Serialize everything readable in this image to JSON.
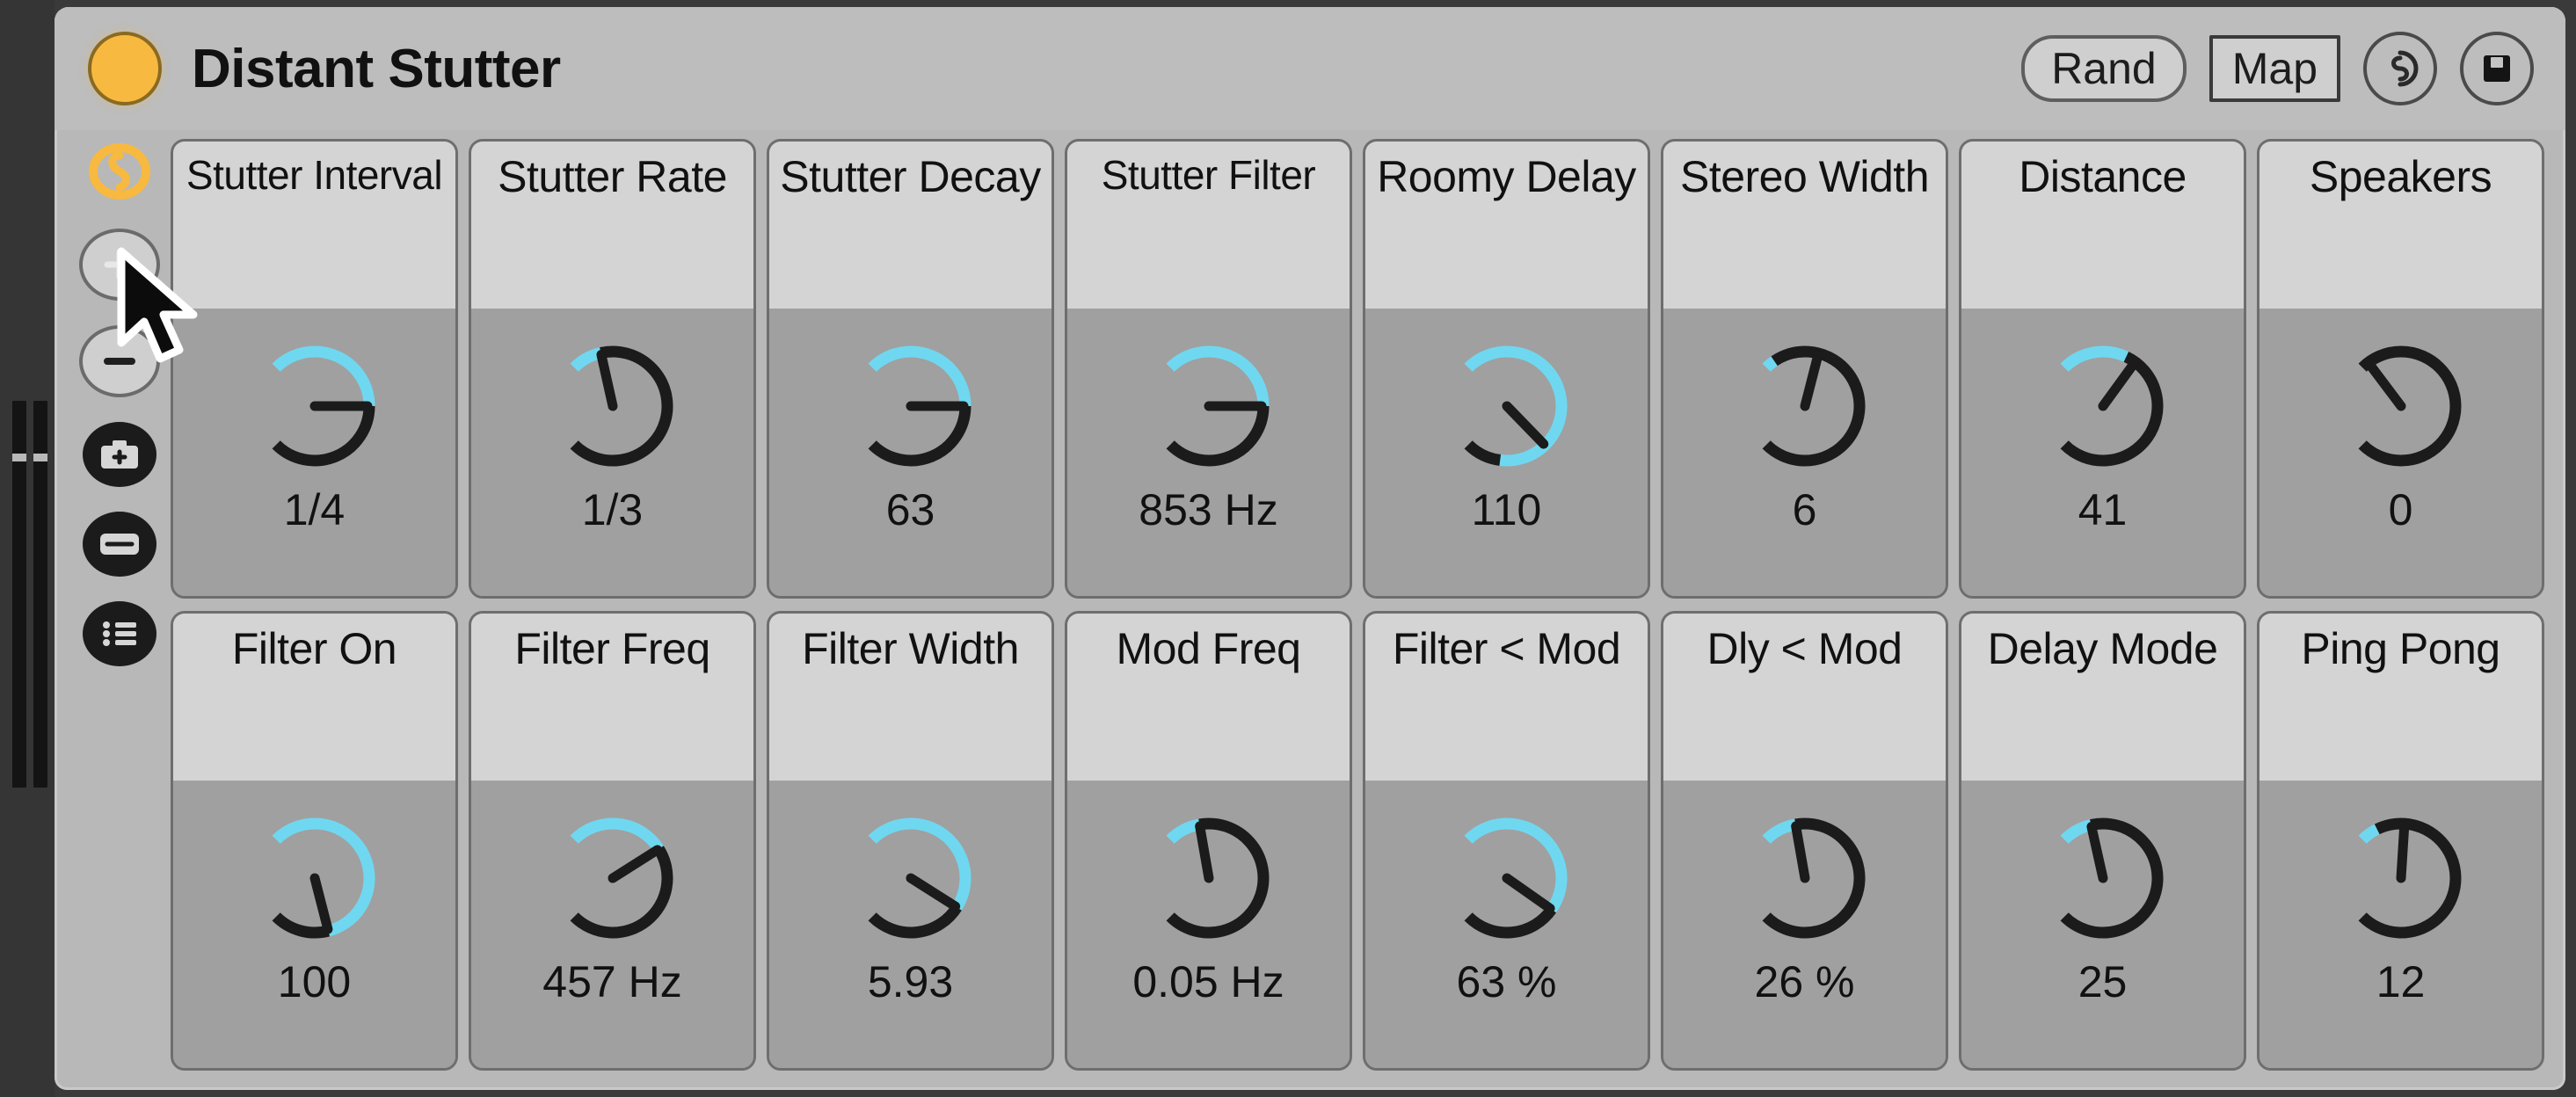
{
  "device": {
    "title": "Distant Stutter",
    "power_state": "on",
    "accent_color": "#f7b93f",
    "knob_active_color": "#6fd8f0",
    "knob_track_color": "#1b1b1b",
    "panel_color": "#b8b8b8"
  },
  "titlebar": {
    "rand_label": "Rand",
    "map_label": "Map",
    "refresh_icon": "refresh-circle-icon",
    "save_icon": "floppy-disk-icon",
    "power_icon": "power-led-icon"
  },
  "toolrail": {
    "items": [
      {
        "name": "power-swirl",
        "icon": "power-swirl-icon",
        "style": "amber"
      },
      {
        "name": "add",
        "icon": "plus-icon",
        "style": "light"
      },
      {
        "name": "remove",
        "icon": "minus-icon",
        "style": "light"
      },
      {
        "name": "snapshot",
        "icon": "camera-plus-icon",
        "style": "dark"
      },
      {
        "name": "bar",
        "icon": "rounded-bar-icon",
        "style": "dark"
      },
      {
        "name": "list",
        "icon": "list-icon",
        "style": "dark"
      }
    ]
  },
  "meters": {
    "channels": [
      "left",
      "right"
    ],
    "tick_label": ""
  },
  "cursor": {
    "icon": "arrow-cursor",
    "over": "add-button"
  },
  "parameters": [
    {
      "label": "Stutter Interval",
      "value": "1/4",
      "fill": 0.5,
      "pointer": 0.5
    },
    {
      "label": "Stutter Rate",
      "value": "1/3",
      "fill": 0.12,
      "pointer": 0.12
    },
    {
      "label": "Stutter Decay",
      "value": "63",
      "fill": 0.5,
      "pointer": 0.5
    },
    {
      "label": "Stutter Filter",
      "value": "853 Hz",
      "fill": 0.5,
      "pointer": 0.5
    },
    {
      "label": "Roomy Delay",
      "value": "110",
      "fill": 0.86,
      "pointer": 0.67
    },
    {
      "label": "Stereo Width",
      "value": "6",
      "fill": 0.04,
      "pointer": 0.22
    },
    {
      "label": "Distance",
      "value": "41",
      "fill": 0.26,
      "pointer": 0.3
    },
    {
      "label": "Speakers",
      "value": "0",
      "fill": 0.0,
      "pointer": 0.03
    },
    {
      "label": "Filter On",
      "value": "100",
      "fill": 0.78,
      "pointer": 0.78
    },
    {
      "label": "Filter Freq",
      "value": "457 Hz",
      "fill": 0.38,
      "pointer": 0.38
    },
    {
      "label": "Filter Width",
      "value": "5.93",
      "fill": 0.62,
      "pointer": 0.62
    },
    {
      "label": "Mod Freq",
      "value": "0.05 Hz",
      "fill": 0.13,
      "pointer": 0.13
    },
    {
      "label": "Filter < Mod",
      "value": "63 %",
      "fill": 0.63,
      "pointer": 0.63
    },
    {
      "label": "Dly < Mod",
      "value": "26 %",
      "fill": 0.13,
      "pointer": 0.13
    },
    {
      "label": "Delay Mode",
      "value": "25",
      "fill": 0.12,
      "pointer": 0.12
    },
    {
      "label": "Ping Pong",
      "value": "12",
      "fill": 0.07,
      "pointer": 0.18
    }
  ]
}
